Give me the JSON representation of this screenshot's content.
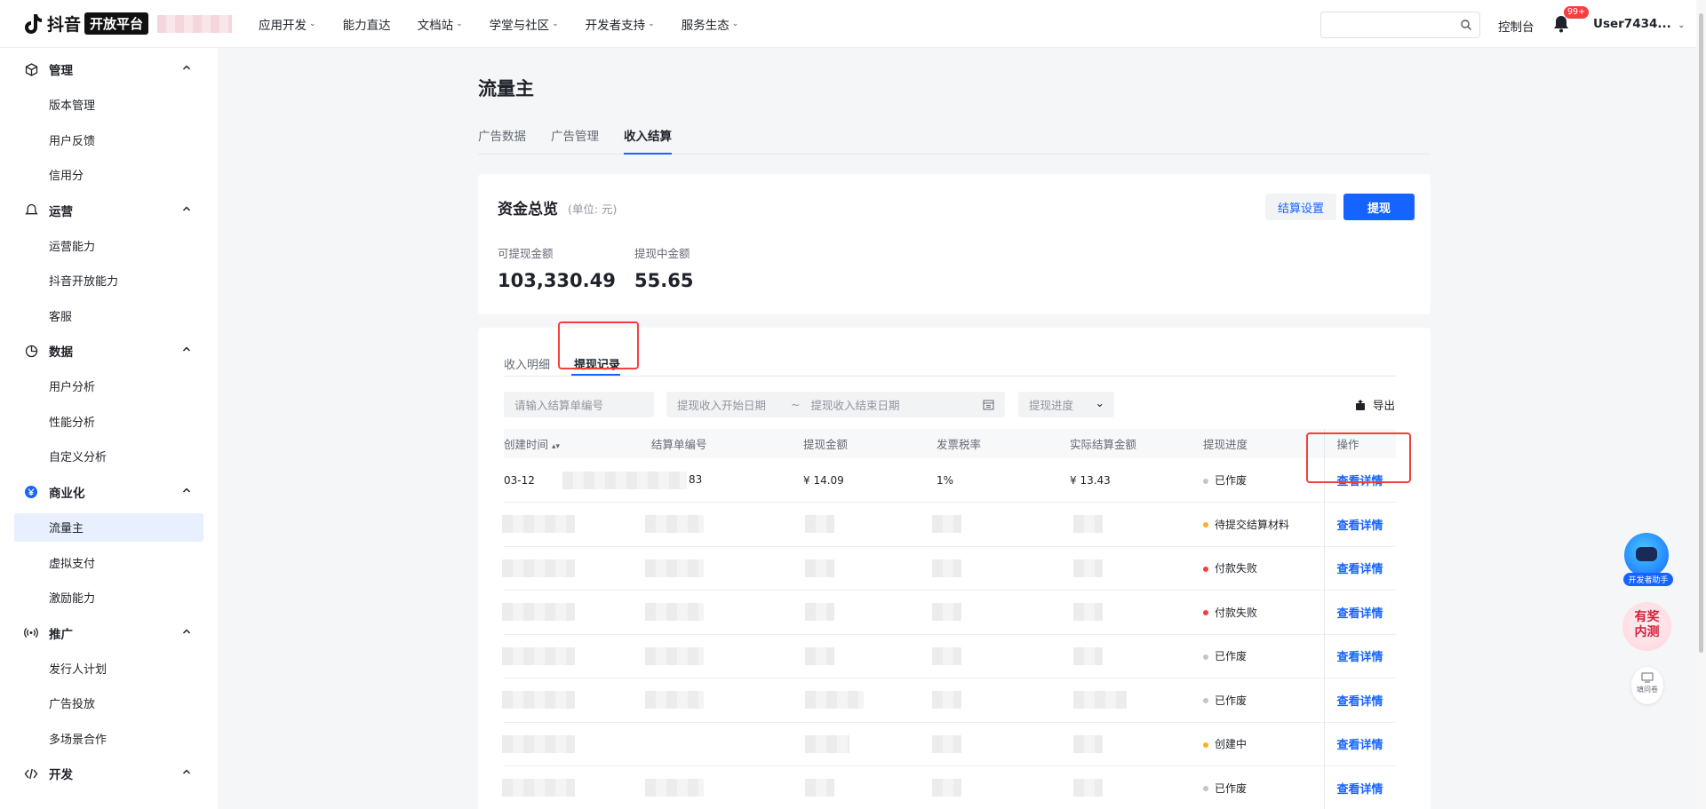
{
  "topnav": {
    "logo_text": "抖音",
    "logo_badge": "开放平台",
    "nav_items": [
      "应用开发",
      "能力直达",
      "文档站",
      "学堂与社区",
      "开发者支持",
      "服务生态"
    ],
    "nav_has_caret": [
      true,
      false,
      true,
      true,
      true,
      true
    ],
    "console": "控制台",
    "notification_count": "99+",
    "user": "User7434..."
  },
  "sidebar": {
    "groups": [
      {
        "label": "管理",
        "icon": "cube-icon",
        "items": [
          "版本管理",
          "用户反馈",
          "信用分"
        ]
      },
      {
        "label": "运营",
        "icon": "bell-outline-icon",
        "items": [
          "运营能力",
          "抖音开放能力",
          "客服"
        ]
      },
      {
        "label": "数据",
        "icon": "pie-chart-icon",
        "items": [
          "用户分析",
          "性能分析",
          "自定义分析"
        ]
      },
      {
        "label": "商业化",
        "icon": "yen-coin-icon",
        "items": [
          "流量主",
          "虚拟支付",
          "激励能力"
        ]
      },
      {
        "label": "推广",
        "icon": "broadcast-icon",
        "items": [
          "发行人计划",
          "广告投放",
          "多场景合作"
        ]
      },
      {
        "label": "开发",
        "icon": "code-icon",
        "items": []
      }
    ],
    "active_item": "流量主"
  },
  "page": {
    "title": "流量主",
    "tabs": [
      "广告数据",
      "广告管理",
      "收入结算"
    ],
    "active_tab": "收入结算"
  },
  "funds": {
    "title": "资金总览",
    "unit": "(单位: 元)",
    "settle_button": "结算设置",
    "withdraw_button": "提现",
    "available_label": "可提现金额",
    "available_value": "103,330.49",
    "pending_label": "提现中金额",
    "pending_value": "55.65"
  },
  "records": {
    "subtabs": [
      "收入明细",
      "提现记录"
    ],
    "active_subtab": "提现记录",
    "filters": {
      "order_placeholder": "请输入结算单编号",
      "start_placeholder": "提现收入开始日期",
      "range_sep": "~",
      "end_placeholder": "提现收入结束日期",
      "progress_placeholder": "提现进度"
    },
    "export": "导出",
    "columns": [
      "创建时间",
      "结算单编号",
      "提现金额",
      "发票税率",
      "实际结算金额",
      "提现进度",
      "操作"
    ],
    "first_row": {
      "time": "03-12",
      "order_suffix": "83",
      "amount": "¥ 14.09",
      "tax": "1%",
      "actual": "¥ 13.43"
    },
    "rows": [
      {
        "status": "已作废",
        "color": "#c2c6cc",
        "action": "查看详情"
      },
      {
        "status": "待提交结算材料",
        "color": "#ffb01f",
        "action": "查看详情"
      },
      {
        "status": "付款失败",
        "color": "#f53f3f",
        "action": "查看详情"
      },
      {
        "status": "付款失败",
        "color": "#f53f3f",
        "action": "查看详情"
      },
      {
        "status": "已作废",
        "color": "#c2c6cc",
        "action": "查看详情"
      },
      {
        "status": "已作废",
        "color": "#c2c6cc",
        "action": "查看详情"
      },
      {
        "status": "创建中",
        "color": "#ffb01f",
        "action": "查看详情"
      },
      {
        "status": "已作废",
        "color": "#c2c6cc",
        "action": "查看详情"
      }
    ]
  },
  "floating": {
    "assistant_label": "开发者助手",
    "prize_label": "有奖内测",
    "survey_label": "填问卷"
  },
  "colors": {
    "accent": "#1664ff",
    "highlight": "#f53f3f"
  }
}
